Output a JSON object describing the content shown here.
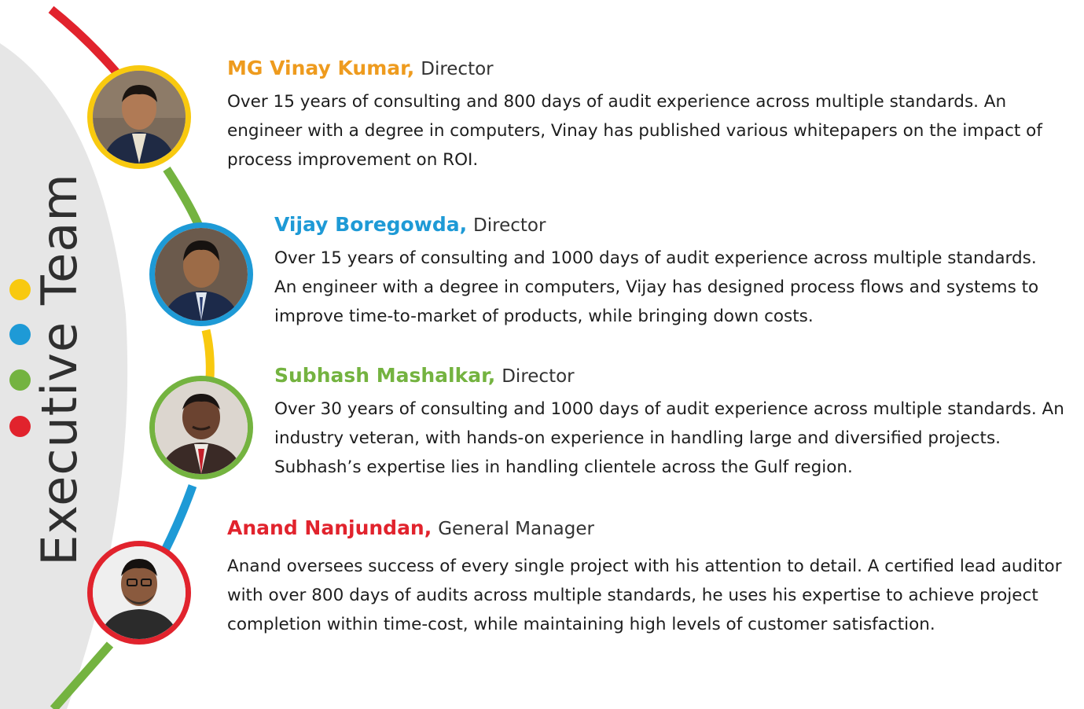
{
  "page": {
    "title": "Executive Team"
  },
  "colors": {
    "red": "#e1232d",
    "green": "#74b340",
    "yellow": "#f8c90f",
    "blue": "#1e9ad6",
    "orange": "#ee9b1e",
    "grey_panel": "#e6e6e6"
  },
  "members": [
    {
      "name": "MG Vinay Kumar,",
      "role": "Director",
      "bio": "Over 15 years of consulting and 800 days of audit experience across multiple standards. An engineer with a degree in computers, Vinay has published various whitepapers on the impact of process improvement on ROI.",
      "name_color": "#ee9b1e",
      "ring_color": "#f8c90f",
      "portrait_icon": "person-photo"
    },
    {
      "name": "Vijay Boregowda,",
      "role": "Director",
      "bio": "Over 15 years of consulting and 1000 days of audit experience across multiple standards. An engineer with a degree in computers, Vijay has designed process flows and systems to improve time-to-market of products, while bringing down costs.",
      "name_color": "#1e9ad6",
      "ring_color": "#1e9ad6",
      "portrait_icon": "person-photo"
    },
    {
      "name": "Subhash Mashalkar,",
      "role": "Director",
      "bio": "Over 30 years of consulting and 1000 days of audit experience across multiple standards. An industry veteran, with hands-on experience in handling large and diversified projects. Subhash’s expertise lies in handling clientele across the Gulf region.",
      "name_color": "#74b340",
      "ring_color": "#74b340",
      "portrait_icon": "person-photo"
    },
    {
      "name": "Anand Nanjundan,",
      "role": "General Manager",
      "bio": "Anand oversees success of every single project with his attention to detail. A certified lead auditor with over 800 days of audits across multiple standards, he uses his expertise to achieve project completion within time-cost, while maintaining high levels of customer satisfaction.",
      "name_color": "#e1232d",
      "ring_color": "#e1232d",
      "portrait_icon": "person-photo"
    }
  ]
}
